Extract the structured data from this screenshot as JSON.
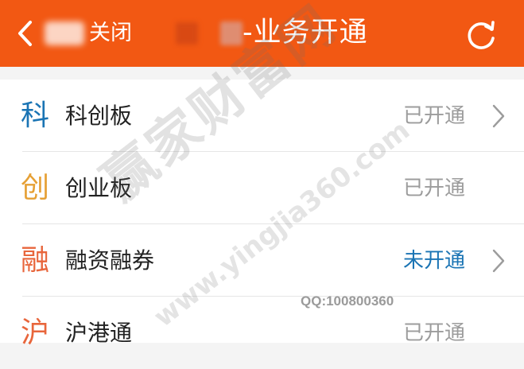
{
  "header": {
    "back_icon": "chevron-left-icon",
    "close_label": "关闭",
    "title": "-业务开通",
    "refresh_icon": "refresh-icon",
    "background": "#f25813"
  },
  "services": [
    {
      "glyph": "科",
      "glyph_color": "#1a74b4",
      "name": "科创板",
      "status": "已开通",
      "has_chevron": true
    },
    {
      "glyph": "创",
      "glyph_color": "#e6a035",
      "name": "创业板",
      "status": "已开通",
      "has_chevron": false
    },
    {
      "glyph": "融",
      "glyph_color": "#e8663c",
      "name": "融资融券",
      "status": "未开通",
      "status_color": "#1a74b4",
      "has_chevron": true
    },
    {
      "glyph": "沪",
      "glyph_color": "#e8663c",
      "name": "沪港通",
      "status": "已开通",
      "has_chevron": false
    }
  ],
  "watermark": {
    "site": "赢家财富网",
    "url": "www.yingjia360.com",
    "qq": "QQ:100800360"
  }
}
